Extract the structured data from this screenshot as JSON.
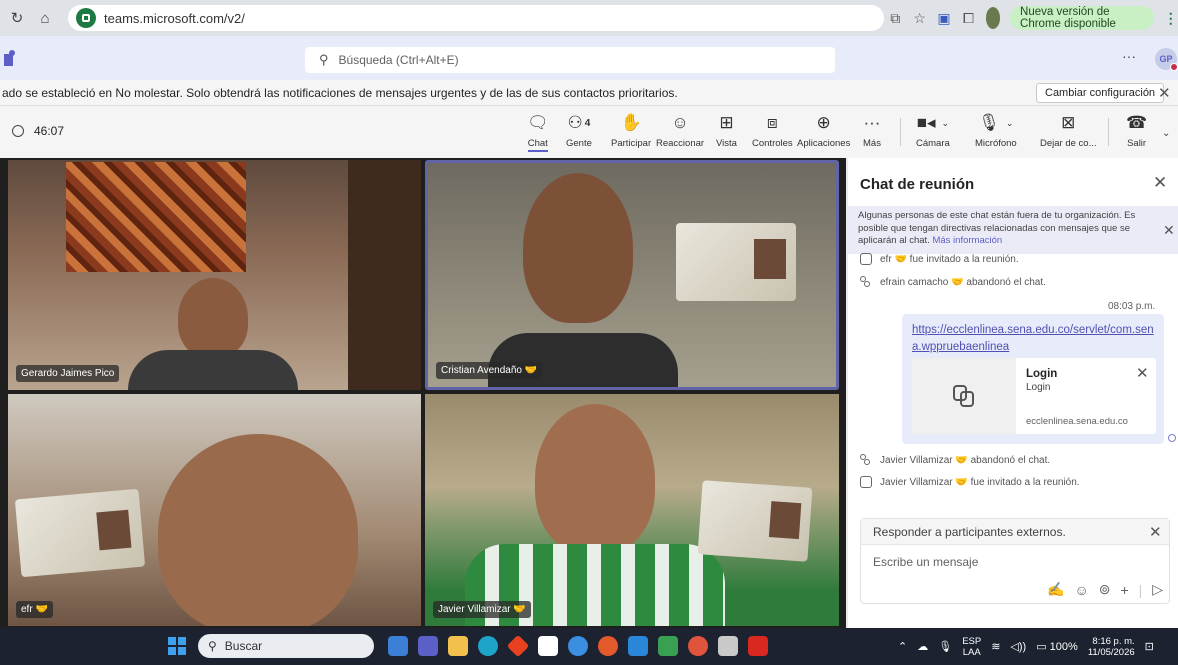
{
  "browser": {
    "url": "teams.microsoft.com/v2/",
    "update_label": "Nueva versión de Chrome disponible"
  },
  "header": {
    "search_placeholder": "Búsqueda (Ctrl+Alt+E)",
    "more": "···",
    "avatar_initials": "GP"
  },
  "notification": {
    "message": "ado se estableció en No molestar. Solo obtendrá las notificaciones de mensajes urgentes y de las de sus contactos prioritarios.",
    "settings_button": "Cambiar configuración"
  },
  "meeting": {
    "elapsed": "46:07",
    "people_count": "4",
    "toolbar": [
      {
        "id": "chat",
        "label": "Chat",
        "icon": "chat-icon"
      },
      {
        "id": "people",
        "label": "Gente",
        "icon": "people-icon"
      },
      {
        "id": "raise",
        "label": "Participar",
        "icon": "raise-hand-icon"
      },
      {
        "id": "react",
        "label": "Reaccionar",
        "icon": "emoji-icon"
      },
      {
        "id": "view",
        "label": "Vista",
        "icon": "grid-icon"
      },
      {
        "id": "controls",
        "label": "Controles",
        "icon": "controls-icon"
      },
      {
        "id": "apps",
        "label": "Aplicaciones",
        "icon": "add-app-icon"
      },
      {
        "id": "more",
        "label": "Más",
        "icon": "more-icon"
      },
      {
        "id": "camera",
        "label": "Cámara",
        "icon": "camera-icon"
      },
      {
        "id": "mic",
        "label": "Micrófono",
        "icon": "mic-icon"
      },
      {
        "id": "stopshare",
        "label": "Dejar de co...",
        "icon": "stop-share-icon"
      },
      {
        "id": "leave",
        "label": "Salir",
        "icon": "hangup-icon"
      }
    ]
  },
  "participants": [
    {
      "name": "Gerardo Jaimes Pico"
    },
    {
      "name": "Cristian Avendaño"
    },
    {
      "name": "efr"
    },
    {
      "name": "Javier Villamizar"
    }
  ],
  "chat": {
    "title": "Chat de reunión",
    "external_notice": "Algunas personas de este chat están fuera de tu organización. Es posible que tengan directivas relacionadas con mensajes que se aplicarán al chat.",
    "more_info": "Más información",
    "events_top": [
      {
        "text": "efr 🤝 fue invitado a la reunión."
      },
      {
        "text": "efrain camacho 🤝 abandonó el chat."
      }
    ],
    "message_time": "08:03 p.m.",
    "message_link": "https://ecclenlinea.sena.edu.co/servlet/com.sena.wppruebaenlinea",
    "preview": {
      "title": "Login",
      "subtitle": "Login",
      "domain": "ecclenlinea.sena.edu.co"
    },
    "events_bottom": [
      {
        "text": "Javier Villamizar 🤝 abandonó el chat."
      },
      {
        "text": "Javier Villamizar 🤝 fue invitado a la reunión."
      }
    ],
    "reply_header": "Responder a participantes externos.",
    "compose_placeholder": "Escribe un mensaje"
  },
  "taskbar": {
    "search": "Buscar",
    "lang": "ESP",
    "lang_sub": "LAA",
    "battery": "100%",
    "time": "8:16 p. m.",
    "date": "11/05/2026"
  }
}
